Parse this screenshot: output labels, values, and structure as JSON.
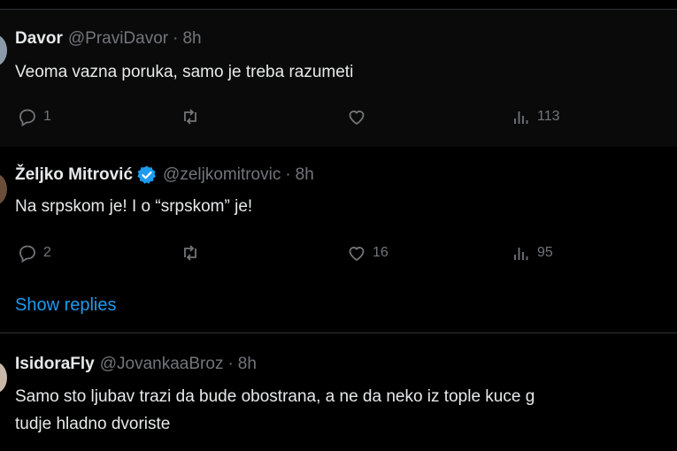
{
  "tweets": [
    {
      "name": "Davor",
      "handle": "@PraviDavor",
      "sep": "·",
      "time": "8h",
      "verified": false,
      "text": "Veoma vazna poruka, samo je treba razumeti",
      "replies": "1",
      "retweets": "",
      "likes": "",
      "views": "113"
    },
    {
      "name": "Željko Mitrović",
      "handle": "@zeljkomitrovic",
      "sep": "·",
      "time": "8h",
      "verified": true,
      "text": "Na srpskom je! I o “srpskom” je!",
      "replies": "2",
      "retweets": "",
      "likes": "16",
      "views": "95",
      "show_replies": "Show replies"
    },
    {
      "name": "IsidoraFly",
      "handle": "@JovankaaBroz",
      "sep": "·",
      "time": "8h",
      "verified": false,
      "text_line1": "Samo sto ljubav trazi da bude obostrana, a ne da neko iz tople kuce g",
      "text_line2": "tudje hladno dvoriste"
    }
  ],
  "icons": {
    "reply": "reply-icon",
    "retweet": "retweet-icon",
    "like": "heart-icon",
    "views": "views-icon",
    "verified": "verified-badge-icon"
  },
  "colors": {
    "background": "#000000",
    "text": "#e7e9ea",
    "muted": "#71767b",
    "link": "#1d9bf0",
    "verified": "#1d9bf0"
  }
}
